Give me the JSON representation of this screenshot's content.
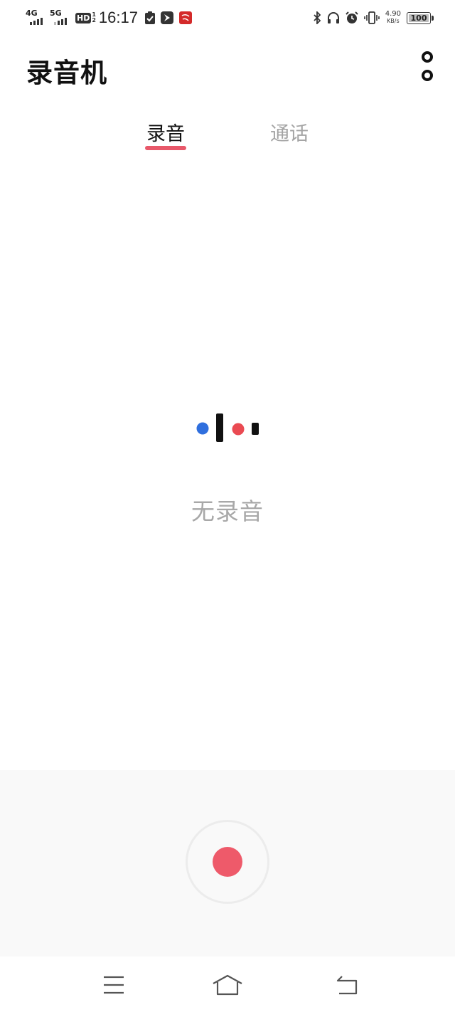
{
  "status_bar": {
    "signal1_label": "4G",
    "signal2_label": "5G",
    "hd_label": "HD",
    "hd_sub_top": "1",
    "hd_sub_bottom": "2",
    "time": "16:17",
    "net_speed_value": "4.90",
    "net_speed_unit": "KB/s",
    "battery_level": "100",
    "icons": [
      "check-clipboard-icon",
      "feather-app-icon",
      "red-app-icon",
      "bluetooth-icon",
      "headphones-icon",
      "alarm-icon",
      "vibrate-icon"
    ]
  },
  "header": {
    "title": "录音机",
    "menu_icon": "more-options-icon"
  },
  "tabs": [
    {
      "label": "录音",
      "active": true
    },
    {
      "label": "通话",
      "active": false
    }
  ],
  "empty_state": {
    "message": "无录音",
    "illustration_colors": {
      "blue": "#2f6fde",
      "red": "#ea4a52",
      "black": "#111111"
    }
  },
  "record_button": {
    "icon": "record-icon",
    "color": "#ee5a6a"
  },
  "nav_bar": {
    "icons": [
      "menu-icon",
      "home-icon",
      "back-icon"
    ]
  },
  "colors": {
    "accent": "#e8586a",
    "inactive_tab": "#a4a4a4",
    "panel_bg": "#f9f9f9"
  }
}
